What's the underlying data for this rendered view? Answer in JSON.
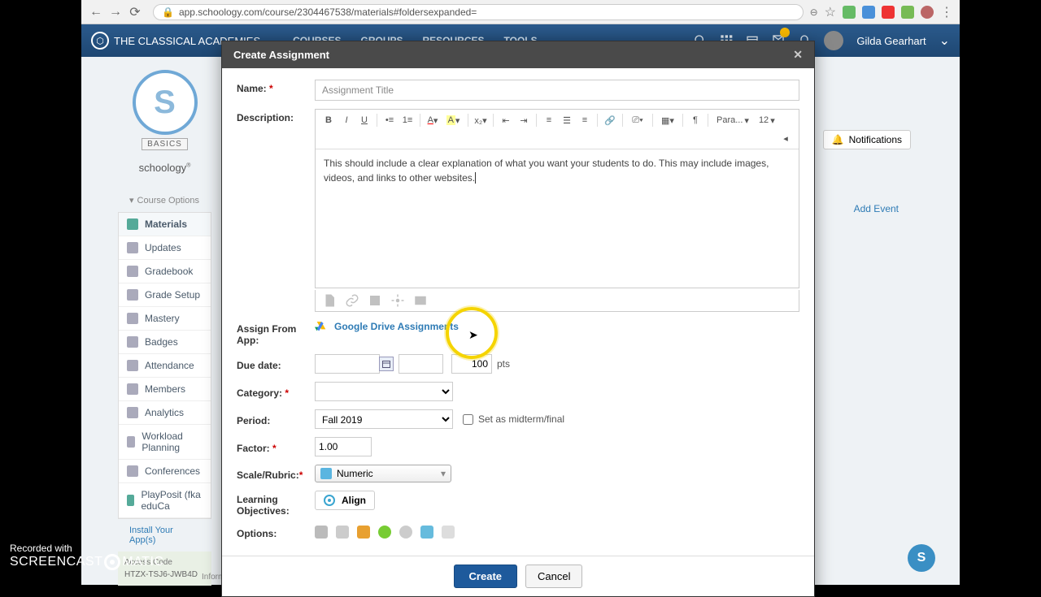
{
  "browser": {
    "url": "app.schoology.com/course/2304467538/materials#foldersexpanded="
  },
  "header": {
    "brand": "THE CLASSICAL ACADEMIES",
    "nav": [
      "COURSES",
      "GROUPS",
      "RESOURCES",
      "TOOLS"
    ],
    "user": "Gilda Gearhart"
  },
  "sidebar": {
    "logo_label": "BASICS",
    "logo_sub": "schoology",
    "course_options": "Course Options",
    "items": [
      {
        "label": "Materials",
        "active": true
      },
      {
        "label": "Updates"
      },
      {
        "label": "Gradebook"
      },
      {
        "label": "Grade Setup"
      },
      {
        "label": "Mastery"
      },
      {
        "label": "Badges"
      },
      {
        "label": "Attendance"
      },
      {
        "label": "Members"
      },
      {
        "label": "Analytics"
      },
      {
        "label": "Workload Planning"
      },
      {
        "label": "Conferences"
      },
      {
        "label": "PlayPosit (fka eduCa"
      }
    ],
    "install": "Install Your App(s)",
    "access_title": "Access Code",
    "access_code": "HTZX-TSJ6-JWB4D",
    "info": "Information"
  },
  "right": {
    "notifications": "Notifications",
    "add_event": "Add Event"
  },
  "modal": {
    "title": "Create Assignment",
    "labels": {
      "name": "Name:",
      "description": "Description:",
      "assign_from": "Assign From App:",
      "due_date": "Due date:",
      "category": "Category:",
      "period": "Period:",
      "factor": "Factor:",
      "scale": "Scale/Rubric:",
      "learning": "Learning Objectives:",
      "options": "Options:"
    },
    "name_value": "Assignment Title",
    "desc_text": "This should include a clear explanation of what you want your students to do. This may include images, videos, and links to other websites. ",
    "toolbar": {
      "para": "Para...",
      "size": "12"
    },
    "gd_label": "Google Drive Assignments",
    "pts_value": "100",
    "pts_label": "pts",
    "period_value": "Fall 2019",
    "midterm_label": "Set as midterm/final",
    "factor_value": "1.00",
    "scale_value": "Numeric",
    "align_label": "Align",
    "create": "Create",
    "cancel": "Cancel"
  },
  "watermark": {
    "line1": "Recorded with",
    "brand": "SCREENCAST",
    "brand2": "MATIC"
  }
}
